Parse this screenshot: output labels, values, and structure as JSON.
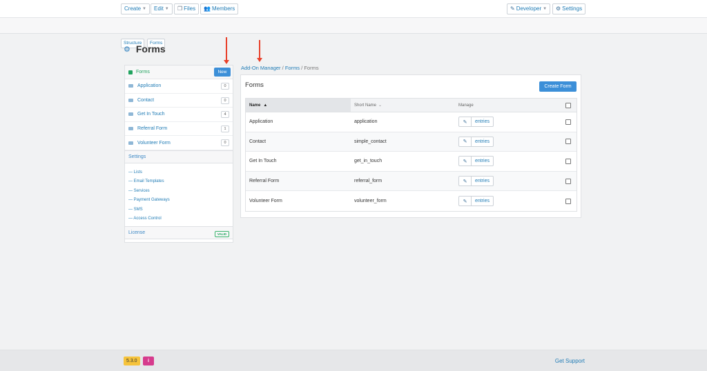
{
  "topnav": {
    "create": "Create",
    "edit": "Edit",
    "files": "Files",
    "members": "Members",
    "developer": "Developer",
    "settings": "Settings"
  },
  "subnav": {
    "structure": "Structure",
    "forms": "Forms"
  },
  "page": {
    "title": "Forms"
  },
  "sidebar": {
    "header": "Forms",
    "new_label": "New",
    "items": [
      {
        "label": "Application",
        "count": "0"
      },
      {
        "label": "Contact",
        "count": "0"
      },
      {
        "label": "Get In Touch",
        "count": "4"
      },
      {
        "label": "Referral Form",
        "count": "1"
      },
      {
        "label": "Volunteer Form",
        "count": "0"
      }
    ],
    "settings_header": "Settings",
    "settings_items": [
      "Lists",
      "Email Templates",
      "Services",
      "Payment Gateways",
      "SMS",
      "Access Control"
    ],
    "license_label": "License",
    "license_status": "VALID"
  },
  "breadcrumb": {
    "root": "Add-On Manager",
    "sep1": " / ",
    "parent": "Forms",
    "sep2": " / ",
    "current": "Forms"
  },
  "panel": {
    "title": "Forms",
    "create_label": "Create Form"
  },
  "table": {
    "headers": {
      "name": "Name",
      "short_name": "Short Name",
      "manage": "Manage"
    },
    "entries_label": "entries",
    "rows": [
      {
        "name": "Application",
        "short_name": "application"
      },
      {
        "name": "Contact",
        "short_name": "simple_contact"
      },
      {
        "name": "Get In Touch",
        "short_name": "get_in_touch"
      },
      {
        "name": "Referral Form",
        "short_name": "referral_form"
      },
      {
        "name": "Volunteer Form",
        "short_name": "volunteer_form"
      }
    ]
  },
  "footer": {
    "version": "5.3.0",
    "info_icon": "i",
    "support": "Get Support"
  },
  "colors": {
    "accent": "#3c8fd8",
    "link": "#1f7bb5",
    "success": "#22a35f",
    "annotation_arrow": "#e8402a",
    "version_badge": "#f6c33b",
    "info_badge": "#d63b8d"
  }
}
